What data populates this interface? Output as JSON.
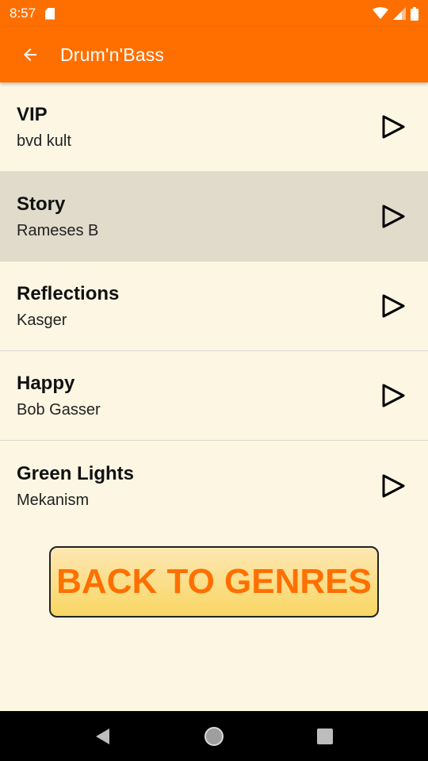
{
  "status_bar": {
    "time": "8:57"
  },
  "app_bar": {
    "title": "Drum'n'Bass"
  },
  "tracks": [
    {
      "title": "VIP",
      "artist": "bvd kult"
    },
    {
      "title": "Story",
      "artist": "Rameses B"
    },
    {
      "title": "Reflections",
      "artist": "Kasger"
    },
    {
      "title": "Happy",
      "artist": "Bob Gasser"
    },
    {
      "title": "Green Lights",
      "artist": "Mekanism"
    }
  ],
  "selected_track_index": 1,
  "back_to_genres_label": "BACK TO GENRES",
  "colors": {
    "primary": "#ff6f00",
    "background": "#fdf6e3",
    "selected_row": "#e0dbcb",
    "button_gradient_top": "#fde7b3",
    "button_gradient_bottom": "#f9d663"
  },
  "icons": {
    "back": "arrow-left-icon",
    "play": "play-outline-icon",
    "wifi": "wifi-icon",
    "signal": "cell-signal-icon",
    "battery": "battery-icon",
    "sd": "sd-card-icon"
  }
}
